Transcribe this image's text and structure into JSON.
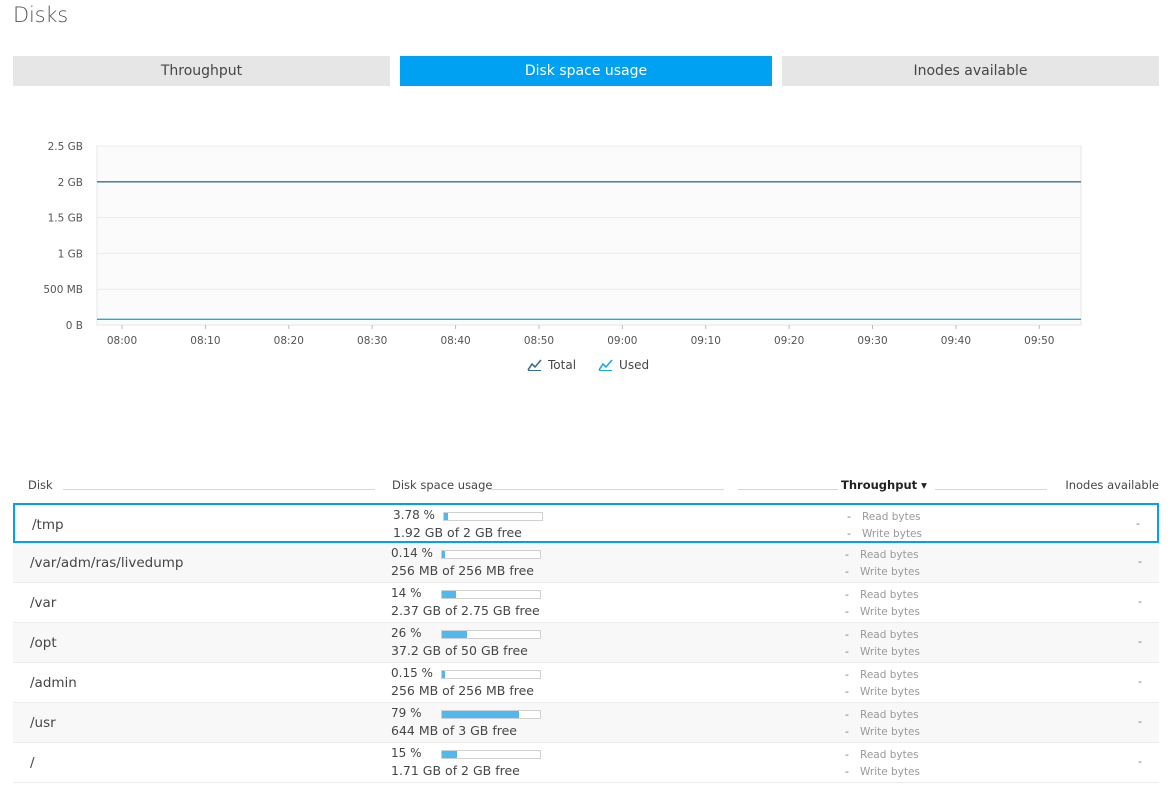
{
  "page": {
    "title": "Disks"
  },
  "tabs": [
    {
      "label": "Throughput",
      "active": false
    },
    {
      "label": "Disk space usage",
      "active": true
    },
    {
      "label": "Inodes available",
      "active": false
    }
  ],
  "colors": {
    "accent": "#00a1f2",
    "total_line": "#3a6f94",
    "used_line": "#1fa7e8",
    "bar_fill": "#4fb8f0"
  },
  "chart_data": {
    "type": "line",
    "title": "",
    "xlabel": "",
    "ylabel": "",
    "y_ticks": [
      "0 B",
      "500 MB",
      "1 GB",
      "1.5 GB",
      "2 GB",
      "2.5 GB"
    ],
    "y_tick_values_gb": [
      0,
      0.5,
      1,
      1.5,
      2,
      2.5
    ],
    "ylim_gb": [
      0,
      2.5
    ],
    "x_ticks": [
      "08:00",
      "08:10",
      "08:20",
      "08:30",
      "08:40",
      "08:50",
      "09:00",
      "09:10",
      "09:20",
      "09:30",
      "09:40",
      "09:50"
    ],
    "x_start": "07:57",
    "x_end": "09:55",
    "grid": true,
    "legend_position": "bottom",
    "series": [
      {
        "name": "Total",
        "x": [
          "07:57",
          "09:55"
        ],
        "values_gb": [
          2,
          2
        ]
      },
      {
        "name": "Used",
        "x": [
          "07:57",
          "09:55"
        ],
        "values_gb": [
          0.08,
          0.08
        ]
      }
    ]
  },
  "legend": {
    "total": "Total",
    "used": "Used"
  },
  "table": {
    "columns": {
      "disk": "Disk",
      "usage": "Disk space usage",
      "throughput": "Throughput ▾",
      "inodes": "Inodes available"
    },
    "rows": [
      {
        "disk": "/tmp",
        "pct_label": "3.78 %",
        "pct": 3.78,
        "free": "1.92 GB of 2 GB free",
        "read_val": "-",
        "read_label": "Read bytes",
        "write_val": "-",
        "write_label": "Write bytes",
        "inodes": "-"
      },
      {
        "disk": "/var/adm/ras/livedump",
        "pct_label": "0.14 %",
        "pct": 0.14,
        "free": "256 MB of 256 MB free",
        "read_val": "-",
        "read_label": "Read bytes",
        "write_val": "-",
        "write_label": "Write bytes",
        "inodes": "-"
      },
      {
        "disk": "/var",
        "pct_label": "14 %",
        "pct": 14,
        "free": "2.37 GB of 2.75 GB free",
        "read_val": "-",
        "read_label": "Read bytes",
        "write_val": "-",
        "write_label": "Write bytes",
        "inodes": "-"
      },
      {
        "disk": "/opt",
        "pct_label": "26 %",
        "pct": 26,
        "free": "37.2 GB of 50 GB free",
        "read_val": "-",
        "read_label": "Read bytes",
        "write_val": "-",
        "write_label": "Write bytes",
        "inodes": "-"
      },
      {
        "disk": "/admin",
        "pct_label": "0.15 %",
        "pct": 0.15,
        "free": "256 MB of 256 MB free",
        "read_val": "-",
        "read_label": "Read bytes",
        "write_val": "-",
        "write_label": "Write bytes",
        "inodes": "-"
      },
      {
        "disk": "/usr",
        "pct_label": "79 %",
        "pct": 79,
        "free": "644 MB of 3 GB free",
        "read_val": "-",
        "read_label": "Read bytes",
        "write_val": "-",
        "write_label": "Write bytes",
        "inodes": "-"
      },
      {
        "disk": "/",
        "pct_label": "15 %",
        "pct": 15,
        "free": "1.71 GB of 2 GB free",
        "read_val": "-",
        "read_label": "Read bytes",
        "write_val": "-",
        "write_label": "Write bytes",
        "inodes": "-"
      }
    ]
  }
}
